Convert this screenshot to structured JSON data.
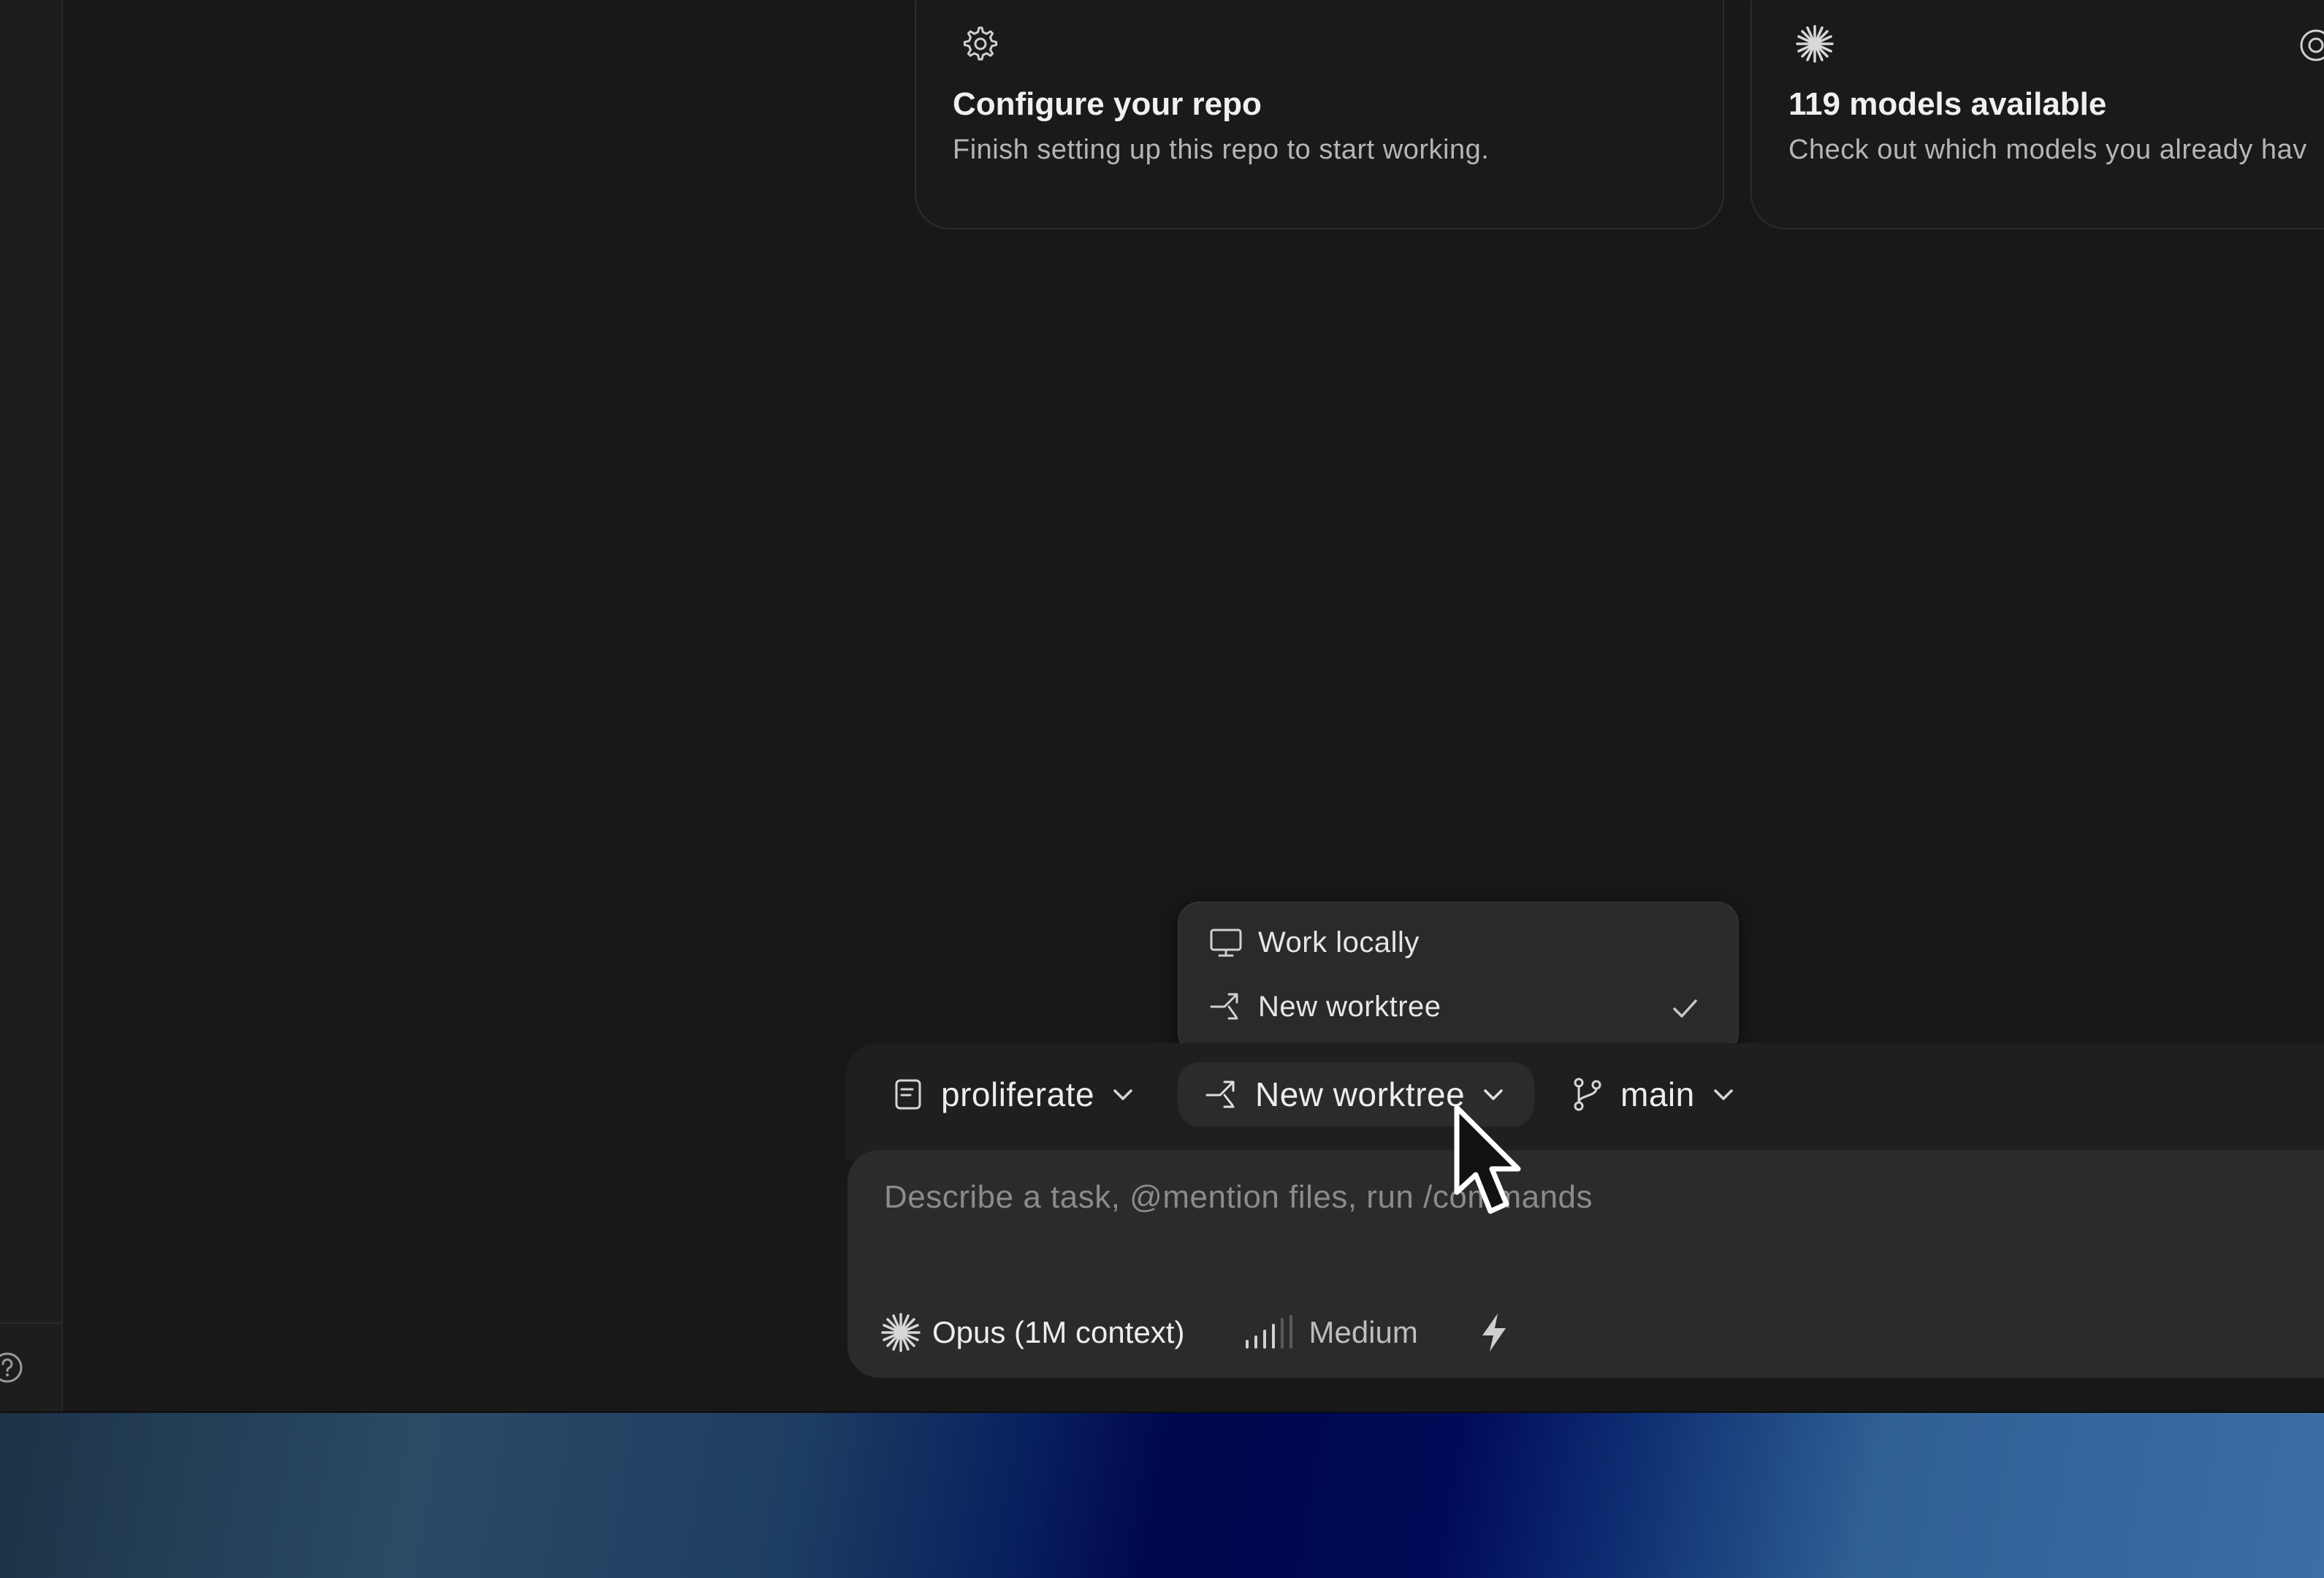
{
  "cards": [
    {
      "title": "Configure your repo",
      "desc": "Finish setting up this repo to start working.",
      "icon": "gear-icon"
    },
    {
      "title": "119 models available",
      "desc": "Check out which models you already hav",
      "icon": "asterisk-icon"
    }
  ],
  "dropdown": {
    "items": [
      {
        "label": "Work locally",
        "icon": "monitor-icon",
        "checked": false
      },
      {
        "label": "New worktree",
        "icon": "worktree-icon",
        "checked": true
      }
    ]
  },
  "toolbar": {
    "repo": "proliferate",
    "worktree": "New worktree",
    "branch": "main"
  },
  "composer": {
    "placeholder": "Describe a task, @mention files, run /commands",
    "model": "Opus (1M context)",
    "effort": "Medium"
  },
  "colors": {
    "background": "#181818",
    "panel": "#2b2b2b",
    "text": "#ededed",
    "muted": "#8b8b8b"
  }
}
